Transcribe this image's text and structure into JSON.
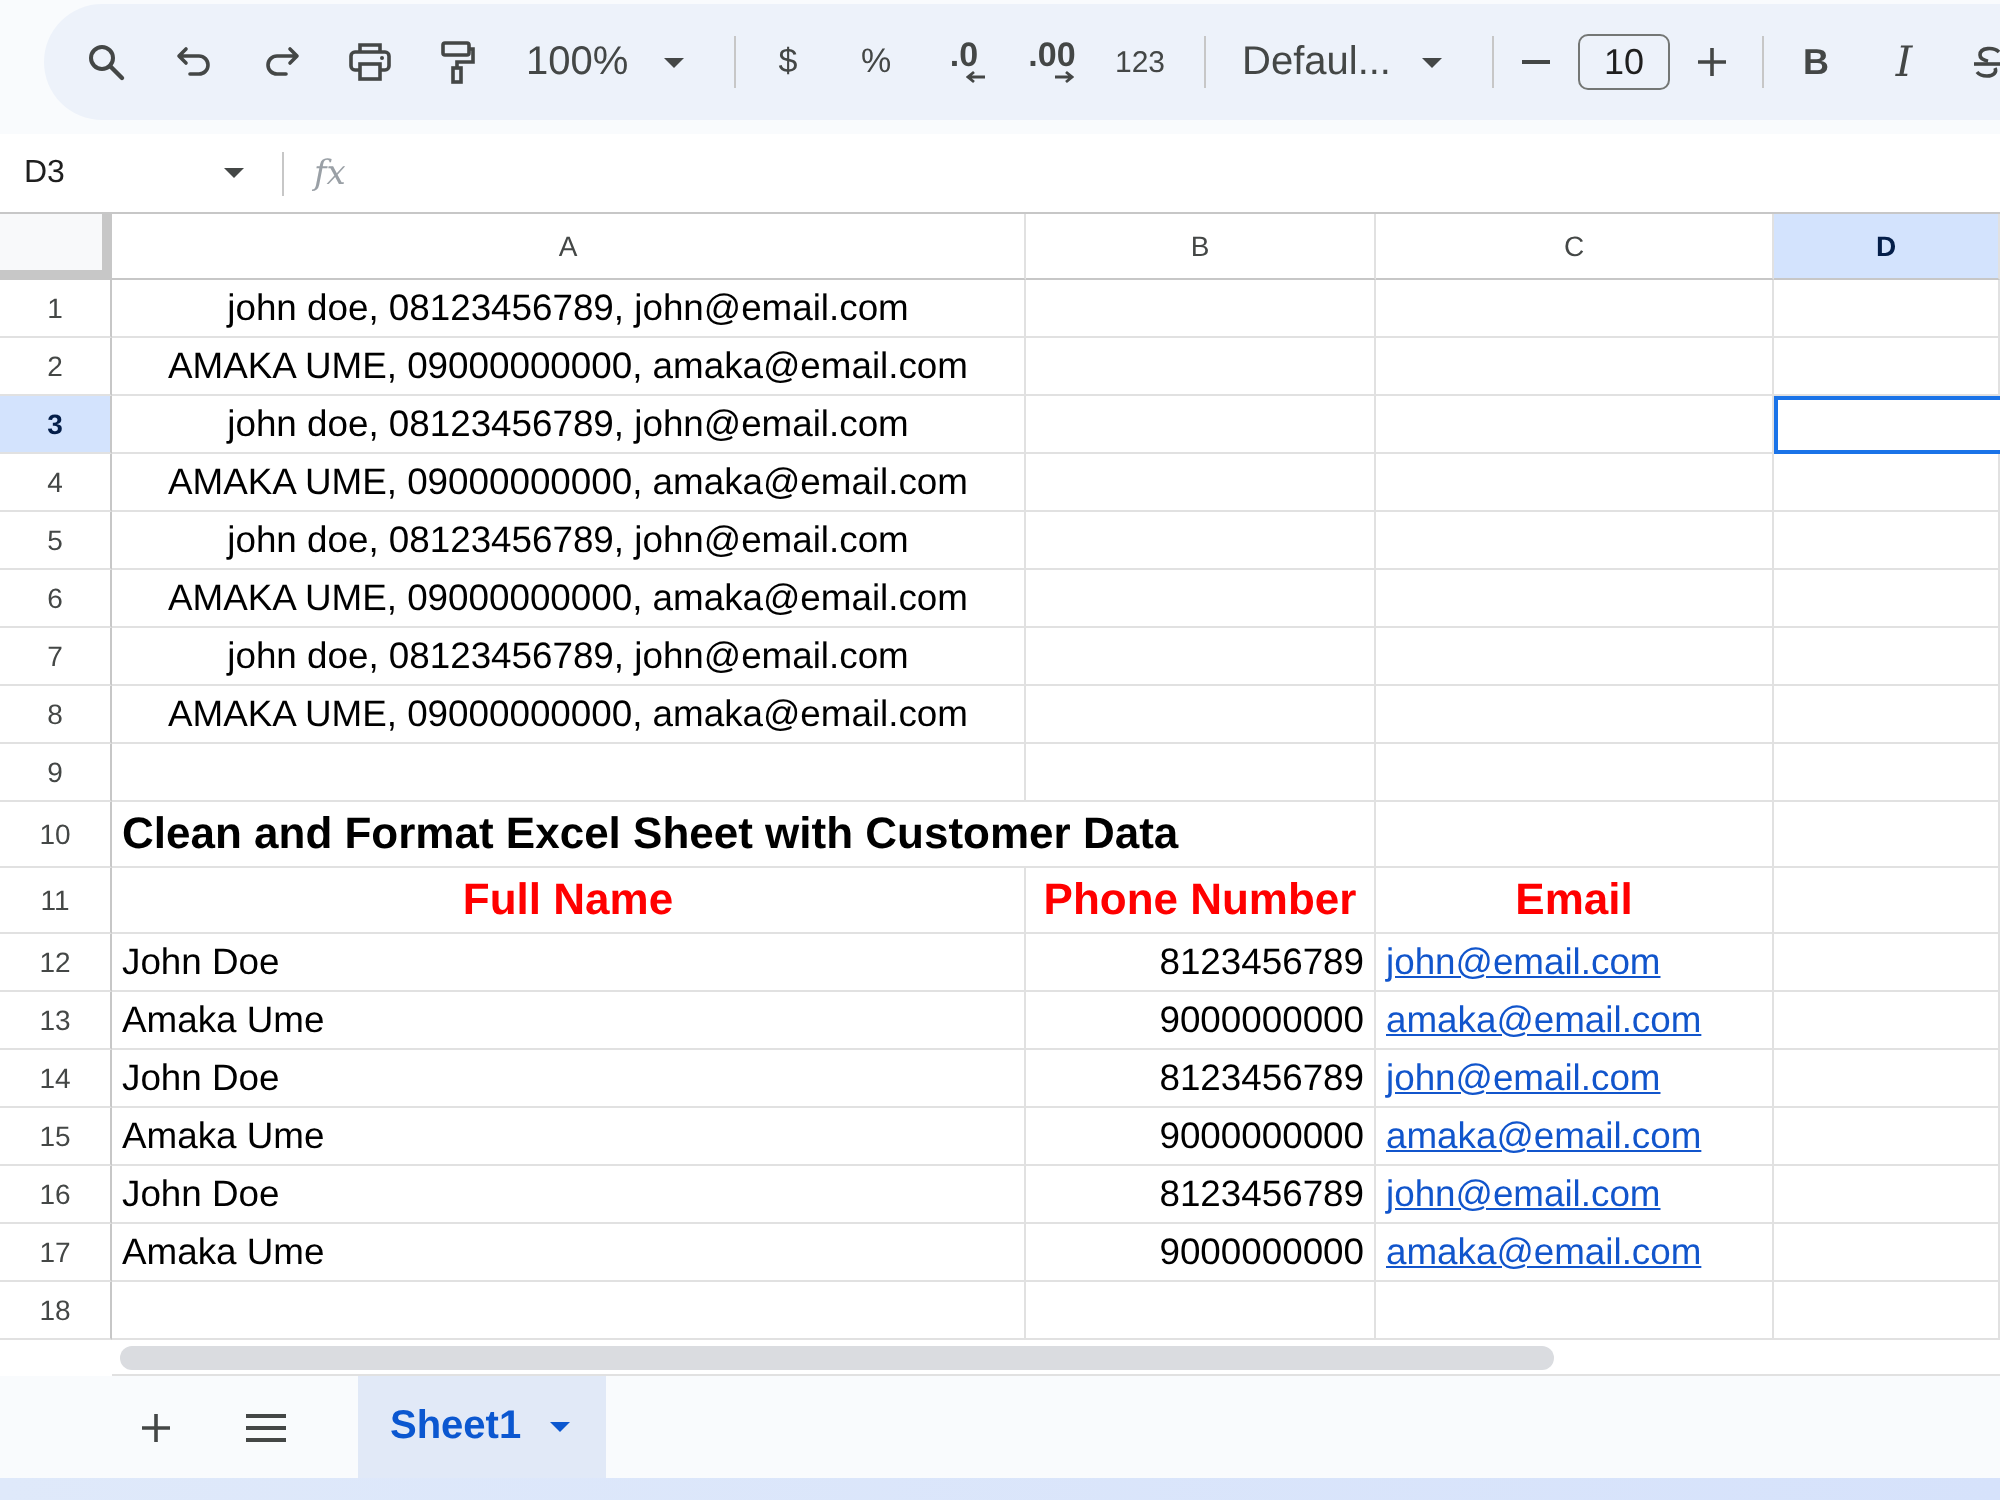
{
  "toolbar": {
    "zoom": "100%",
    "currency": "$",
    "percent": "%",
    "decimals": [
      {
        "label": ".0",
        "kind": "decrease"
      },
      {
        "label": ".00",
        "kind": "increase"
      }
    ],
    "number_format": "123",
    "font": "Defaul...",
    "font_size": "10",
    "bold": "B",
    "italic": "I"
  },
  "formula_bar": {
    "name_box": "D3",
    "fx": "fx"
  },
  "grid": {
    "columns": [
      {
        "label": "A",
        "selected": false
      },
      {
        "label": "B",
        "selected": false
      },
      {
        "label": "C",
        "selected": false
      },
      {
        "label": "D",
        "selected": true
      }
    ],
    "rows": [
      {
        "number": "1",
        "kind": "raw",
        "selected": false,
        "cells": [
          "john doe, 08123456789, john@email.com"
        ]
      },
      {
        "number": "2",
        "kind": "raw",
        "selected": false,
        "cells": [
          "AMAKA UME, 09000000000, amaka@email.com"
        ]
      },
      {
        "number": "3",
        "kind": "raw",
        "selected": true,
        "cells": [
          "john doe, 08123456789, john@email.com"
        ]
      },
      {
        "number": "4",
        "kind": "raw",
        "selected": false,
        "cells": [
          "AMAKA UME, 09000000000, amaka@email.com"
        ]
      },
      {
        "number": "5",
        "kind": "raw",
        "selected": false,
        "cells": [
          "john doe, 08123456789, john@email.com"
        ]
      },
      {
        "number": "6",
        "kind": "raw",
        "selected": false,
        "cells": [
          "AMAKA UME, 09000000000, amaka@email.com"
        ]
      },
      {
        "number": "7",
        "kind": "raw",
        "selected": false,
        "cells": [
          "john doe, 08123456789, john@email.com"
        ]
      },
      {
        "number": "8",
        "kind": "raw",
        "selected": false,
        "cells": [
          "AMAKA UME, 09000000000, amaka@email.com"
        ]
      },
      {
        "number": "9",
        "kind": "blank",
        "selected": false,
        "cells": []
      },
      {
        "number": "10",
        "kind": "title",
        "selected": false,
        "cells": [
          "Clean and Format Excel Sheet with Customer Data"
        ]
      },
      {
        "number": "11",
        "kind": "header",
        "selected": false,
        "cells": [
          "Full Name",
          "Phone Number",
          "Email"
        ]
      },
      {
        "number": "12",
        "kind": "record",
        "selected": false,
        "cells": [
          "John Doe",
          "8123456789",
          "john@email.com"
        ]
      },
      {
        "number": "13",
        "kind": "record",
        "selected": false,
        "cells": [
          "Amaka Ume",
          "9000000000",
          "amaka@email.com"
        ]
      },
      {
        "number": "14",
        "kind": "record",
        "selected": false,
        "cells": [
          "John Doe",
          "8123456789",
          "john@email.com"
        ]
      },
      {
        "number": "15",
        "kind": "record",
        "selected": false,
        "cells": [
          "Amaka Ume",
          "9000000000",
          "amaka@email.com"
        ]
      },
      {
        "number": "16",
        "kind": "record",
        "selected": false,
        "cells": [
          "John Doe",
          "8123456789",
          "john@email.com"
        ]
      },
      {
        "number": "17",
        "kind": "record",
        "selected": false,
        "cells": [
          "Amaka Ume",
          "9000000000",
          "amaka@email.com"
        ]
      },
      {
        "number": "18",
        "kind": "blank",
        "selected": false,
        "cells": []
      }
    ]
  },
  "sheet_tabs": [
    {
      "label": "Sheet1",
      "selected": true
    }
  ]
}
